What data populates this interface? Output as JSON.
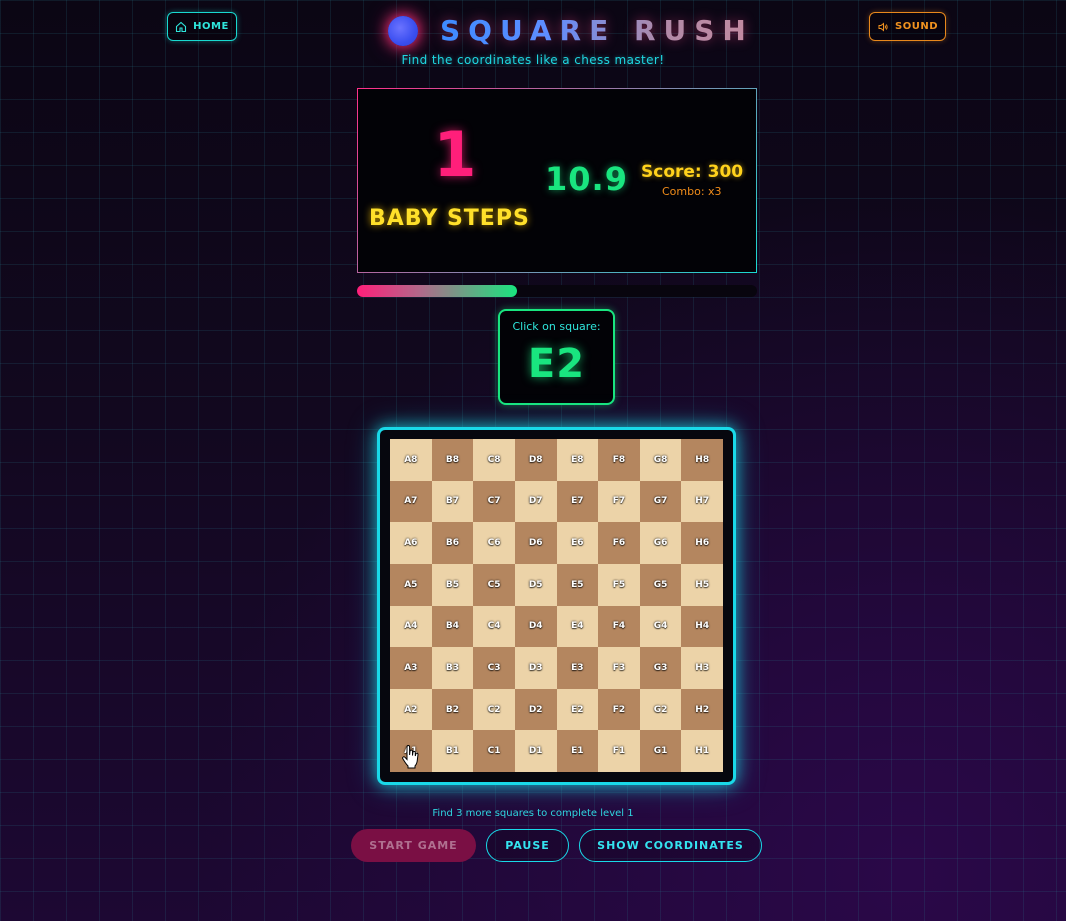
{
  "header": {
    "home_label": "HOME",
    "sound_label": "SOUND",
    "title": "SQUARE RUSH",
    "subtitle": "Find the coordinates like a chess master!"
  },
  "stats": {
    "level": "1",
    "level_name": "BABY STEPS",
    "timer": "10.9",
    "score": "Score: 300",
    "combo": "Combo: x3",
    "progress_fraction": 0.4
  },
  "target": {
    "label": "Click on square:",
    "value": "E2"
  },
  "board": {
    "rows": [
      [
        "A8",
        "B8",
        "C8",
        "D8",
        "E8",
        "F8",
        "G8",
        "H8"
      ],
      [
        "A7",
        "B7",
        "C7",
        "D7",
        "E7",
        "F7",
        "G7",
        "H7"
      ],
      [
        "A6",
        "B6",
        "C6",
        "D6",
        "E6",
        "F6",
        "G6",
        "H6"
      ],
      [
        "A5",
        "B5",
        "C5",
        "D5",
        "E5",
        "F5",
        "G5",
        "H5"
      ],
      [
        "A4",
        "B4",
        "C4",
        "D4",
        "E4",
        "F4",
        "G4",
        "H4"
      ],
      [
        "A3",
        "B3",
        "C3",
        "D3",
        "E3",
        "F3",
        "G3",
        "H3"
      ],
      [
        "A2",
        "B2",
        "C2",
        "D2",
        "E2",
        "F2",
        "G2",
        "H2"
      ],
      [
        "A1",
        "B1",
        "C1",
        "D1",
        "E1",
        "F1",
        "G1",
        "H1"
      ]
    ],
    "light_color": "#ecd3a8",
    "dark_color": "#b4865f"
  },
  "footer": {
    "hint": "Find 3 more squares to complete level 1",
    "start_label": "START GAME",
    "pause_label": "PAUSE",
    "coords_label": "SHOW COORDINATES"
  },
  "colors": {
    "accent_cyan": "#19d9e8",
    "accent_pink": "#ff1f7a",
    "accent_green": "#19e57f",
    "accent_yellow": "#ffe02a",
    "accent_orange": "#f0921f"
  }
}
